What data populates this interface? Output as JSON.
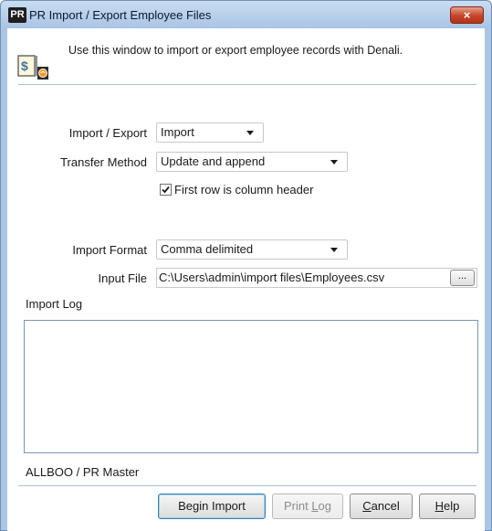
{
  "window": {
    "app_badge": "PR",
    "title": "PR Import / Export Employee Files",
    "close_glyph": "×"
  },
  "header": {
    "icon": "import-export-document-icon",
    "description": "Use this window to import or export employee records with Denali."
  },
  "form": {
    "import_export_label": "Import / Export",
    "import_export_value": "Import",
    "transfer_method_label": "Transfer Method",
    "transfer_method_value": "Update and append",
    "first_row_header_label": "First row is column header",
    "first_row_header_checked": true,
    "import_format_label": "Import Format",
    "import_format_value": "Comma delimited",
    "input_file_label": "Input File",
    "input_file_value": "C:\\Users\\admin\\import files\\Employees.csv",
    "browse_label": "..."
  },
  "log": {
    "label": "Import Log",
    "content": ""
  },
  "status": {
    "company_text": "ALLBOO / PR  Master"
  },
  "buttons": {
    "begin_import": "Begin Import",
    "print_log_pre": "Print ",
    "print_log_accel": "L",
    "print_log_post": "og",
    "cancel_accel": "C",
    "cancel_post": "ancel",
    "help_accel": "H",
    "help_post": "elp"
  },
  "colors": {
    "titlebar": "#aac6e6",
    "close_button": "#c4442a",
    "divider": "#a9c1dd",
    "default_button_border": "#3c7fb1"
  }
}
